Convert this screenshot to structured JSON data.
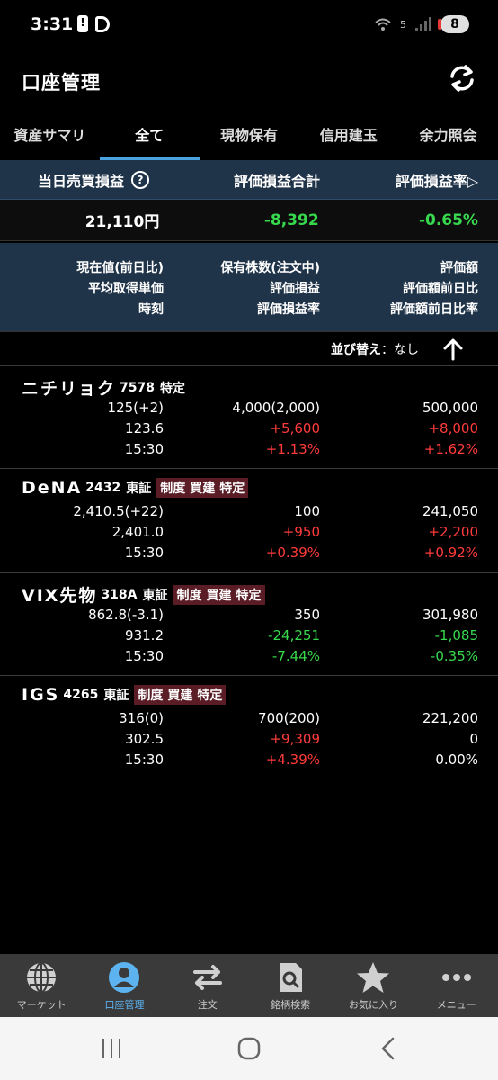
{
  "status_bar": {
    "time": "3:31",
    "wifi": "5",
    "battery": "8"
  },
  "header": {
    "title": "口座管理"
  },
  "tabs": [
    {
      "label": "資産サマリ",
      "active": false
    },
    {
      "label": "全て",
      "active": true
    },
    {
      "label": "現物保有",
      "active": false
    },
    {
      "label": "信用建玉",
      "active": false
    },
    {
      "label": "余力照会",
      "active": false
    }
  ],
  "summary": {
    "headers": [
      "当日売買損益",
      "評価損益合計",
      "評価損益率▷"
    ],
    "values": [
      "21,110円",
      "-8,392",
      "-0.65%"
    ],
    "colors": [
      "#ffffff",
      "#37d84d",
      "#37d84d"
    ]
  },
  "legend": {
    "row1": [
      "現在値(前日比)",
      "保有株数(注文中)",
      "評価額"
    ],
    "row2": [
      "平均取得単価",
      "評価損益",
      "評価額前日比"
    ],
    "row3": [
      "時刻",
      "評価損益率",
      "評価額前日比率"
    ]
  },
  "sort": {
    "label": "並び替え",
    "colon": "：",
    "value": "なし"
  },
  "stocks": [
    {
      "name": "ニチリョク",
      "code": "7578",
      "market": "",
      "tags": [],
      "plain_tag": "特定",
      "row1": [
        "125(+2)",
        "4,000(2,000)",
        "500,000"
      ],
      "row2": [
        "123.6",
        "+5,600",
        "+8,000"
      ],
      "row3": [
        "15:30",
        "+1.13%",
        "+1.62%"
      ],
      "colors": {
        "r1c2": "white",
        "r1c3": "white",
        "r2c2": "red",
        "r2c3": "red",
        "r3c2": "red",
        "r3c3": "red"
      }
    },
    {
      "name": "DeNA",
      "code": "2432",
      "market": "東証",
      "tags": [
        "制度",
        "買建",
        "特定"
      ],
      "plain_tag": "",
      "row1": [
        "2,410.5(+22)",
        "100",
        "241,050"
      ],
      "row2": [
        "2,401.0",
        "+950",
        "+2,200"
      ],
      "row3": [
        "15:30",
        "+0.39%",
        "+0.92%"
      ],
      "colors": {
        "r1c2": "white",
        "r1c3": "white",
        "r2c2": "red",
        "r2c3": "red",
        "r3c2": "red",
        "r3c3": "red"
      }
    },
    {
      "name": "VIX先物",
      "code": "318A",
      "market": "東証",
      "tags": [
        "制度",
        "買建",
        "特定"
      ],
      "plain_tag": "",
      "row1": [
        "862.8(-3.1)",
        "350",
        "301,980"
      ],
      "row2": [
        "931.2",
        "-24,251",
        "-1,085"
      ],
      "row3": [
        "15:30",
        "-7.44%",
        "-0.35%"
      ],
      "colors": {
        "r1c2": "white",
        "r1c3": "white",
        "r2c2": "green",
        "r2c3": "green",
        "r3c2": "green",
        "r3c3": "green"
      }
    },
    {
      "name": "IGS",
      "code": "4265",
      "market": "東証",
      "tags": [
        "制度",
        "買建",
        "特定"
      ],
      "plain_tag": "",
      "row1": [
        "316(0)",
        "700(200)",
        "221,200"
      ],
      "row2": [
        "302.5",
        "+9,309",
        "0"
      ],
      "row3": [
        "15:30",
        "+4.39%",
        "0.00%"
      ],
      "colors": {
        "r1c2": "white",
        "r1c3": "white",
        "r2c2": "red",
        "r2c3": "white",
        "r3c2": "red",
        "r3c3": "white"
      }
    }
  ],
  "bottom_nav": [
    {
      "label": "マーケット",
      "icon": "globe-icon",
      "active": false
    },
    {
      "label": "口座管理",
      "icon": "account-icon",
      "active": true
    },
    {
      "label": "注文",
      "icon": "order-arrows-icon",
      "active": false
    },
    {
      "label": "銘柄検索",
      "icon": "stock-search-icon",
      "active": false
    },
    {
      "label": "お気に入り",
      "icon": "star-icon",
      "active": false
    },
    {
      "label": "メニュー",
      "icon": "more-dots-icon",
      "active": false
    }
  ],
  "theme": {
    "accent": "#4aa3df",
    "header_bg": "#1f3349",
    "positive": "#ff3b3b",
    "negative": "#37d84d"
  }
}
